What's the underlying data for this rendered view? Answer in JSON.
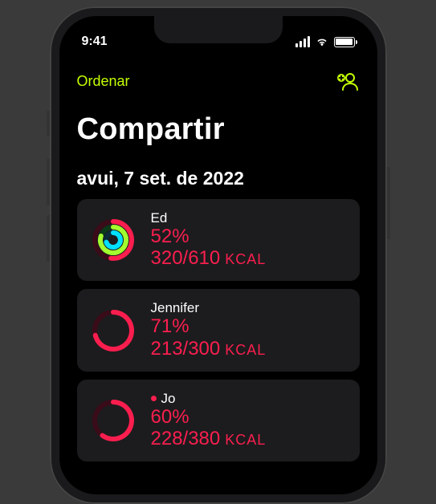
{
  "status": {
    "time": "9:41"
  },
  "nav": {
    "sort_label": "Ordenar"
  },
  "page": {
    "title": "Compartir",
    "date": "avui, 7 set. de 2022"
  },
  "accent_color": "#c3ff00",
  "move_color": "#fa1e4e",
  "unit_label": "KCAL",
  "friends": [
    {
      "name": "Ed",
      "percent": "52%",
      "progress": "320/610",
      "is_me": false,
      "rings": {
        "move": 0.52,
        "exercise": 0.8,
        "stand": 0.7,
        "multi": true
      }
    },
    {
      "name": "Jennifer",
      "percent": "71%",
      "progress": "213/300",
      "is_me": false,
      "rings": {
        "move": 0.71,
        "exercise": 0.0,
        "stand": 0.0,
        "multi": false
      }
    },
    {
      "name": "Jo",
      "percent": "60%",
      "progress": "228/380",
      "is_me": true,
      "rings": {
        "move": 0.6,
        "exercise": 0.0,
        "stand": 0.0,
        "multi": false
      }
    }
  ]
}
